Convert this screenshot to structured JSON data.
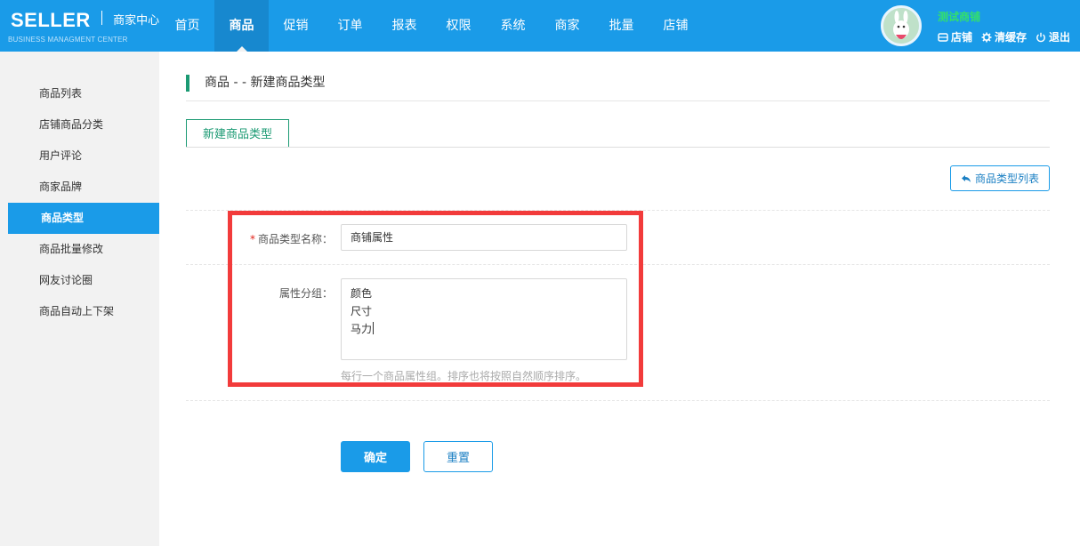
{
  "header": {
    "logo_main": "SELLER",
    "logo_sub": "商家中心",
    "logo_en": "BUSINESS MANAGMENT CENTER",
    "nav": [
      "首页",
      "商品",
      "促销",
      "订单",
      "报表",
      "权限",
      "系统",
      "商家",
      "批量",
      "店铺"
    ],
    "active_nav": "商品",
    "shop_name": "测试商铺",
    "actions": {
      "store": "店铺",
      "clear_cache": "清缓存",
      "logout": "退出"
    },
    "icons": [
      "store-icon",
      "gear-icon",
      "power-icon"
    ]
  },
  "sidebar": {
    "items": [
      "商品列表",
      "店铺商品分类",
      "用户评论",
      "商家品牌",
      "商品类型",
      "商品批量修改",
      "网友讨论圈",
      "商品自动上下架"
    ],
    "active": "商品类型"
  },
  "main": {
    "title": "商品 - - 新建商品类型",
    "tab": "新建商品类型",
    "list_button": "商品类型列表",
    "form": {
      "name_label": "商品类型名称：",
      "name_value": "商铺属性",
      "groups_label": "属性分组：",
      "groups_lines": [
        "颜色",
        "尺寸",
        "马力"
      ],
      "hint": "每行一个商品属性组。排序也将按照自然顺序排序。"
    },
    "submit": "确定",
    "reset": "重置"
  },
  "colors": {
    "primary": "#1a9be8",
    "accent_green": "#1b9a73",
    "shop_name": "#33e06b",
    "highlight": "#f23b3b"
  }
}
